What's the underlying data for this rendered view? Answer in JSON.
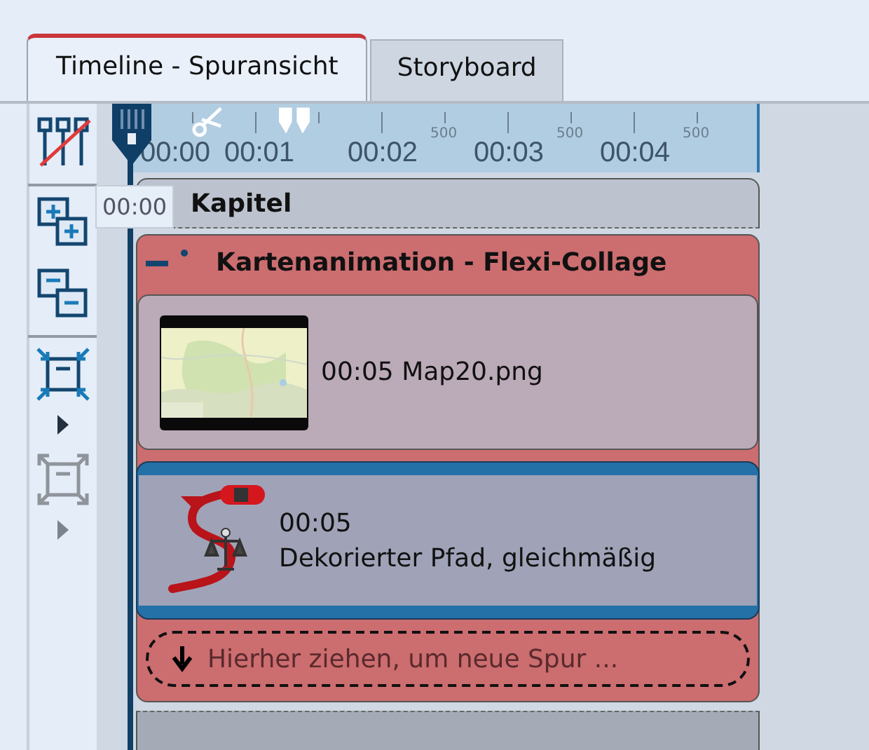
{
  "tabs": [
    {
      "label": "Timeline - Spuransicht",
      "selected": true
    },
    {
      "label": "Storyboard",
      "selected": false
    }
  ],
  "toolbar": [
    {
      "kind": "tracks-off",
      "disabled": false,
      "submenu": false
    },
    {
      "kind": "add",
      "disabled": false,
      "submenu": false
    },
    {
      "kind": "remove",
      "disabled": false,
      "submenu": false
    },
    {
      "kind": "compress",
      "disabled": false,
      "submenu": true
    },
    {
      "kind": "expand",
      "disabled": true,
      "submenu": true
    }
  ],
  "ruler": {
    "seconds": [
      "00:00",
      "00:01",
      "00:02",
      "00:03",
      "00:04"
    ],
    "half_marks": [
      "500",
      "500",
      "500"
    ]
  },
  "tooltip": "00:00",
  "chapter": {
    "title": "Kapitel"
  },
  "group": {
    "title": "Kartenanimation - Flexi-Collage",
    "expanded": true
  },
  "clips": [
    {
      "duration": "00:05",
      "name": "Map20.png",
      "selected": false
    },
    {
      "kind": "effect",
      "duration": "00:05",
      "name": "Dekorierter Pfad, gleichmäßig",
      "selected": true
    }
  ],
  "drop_zone": "Hierher ziehen, um neue Spur ..."
}
